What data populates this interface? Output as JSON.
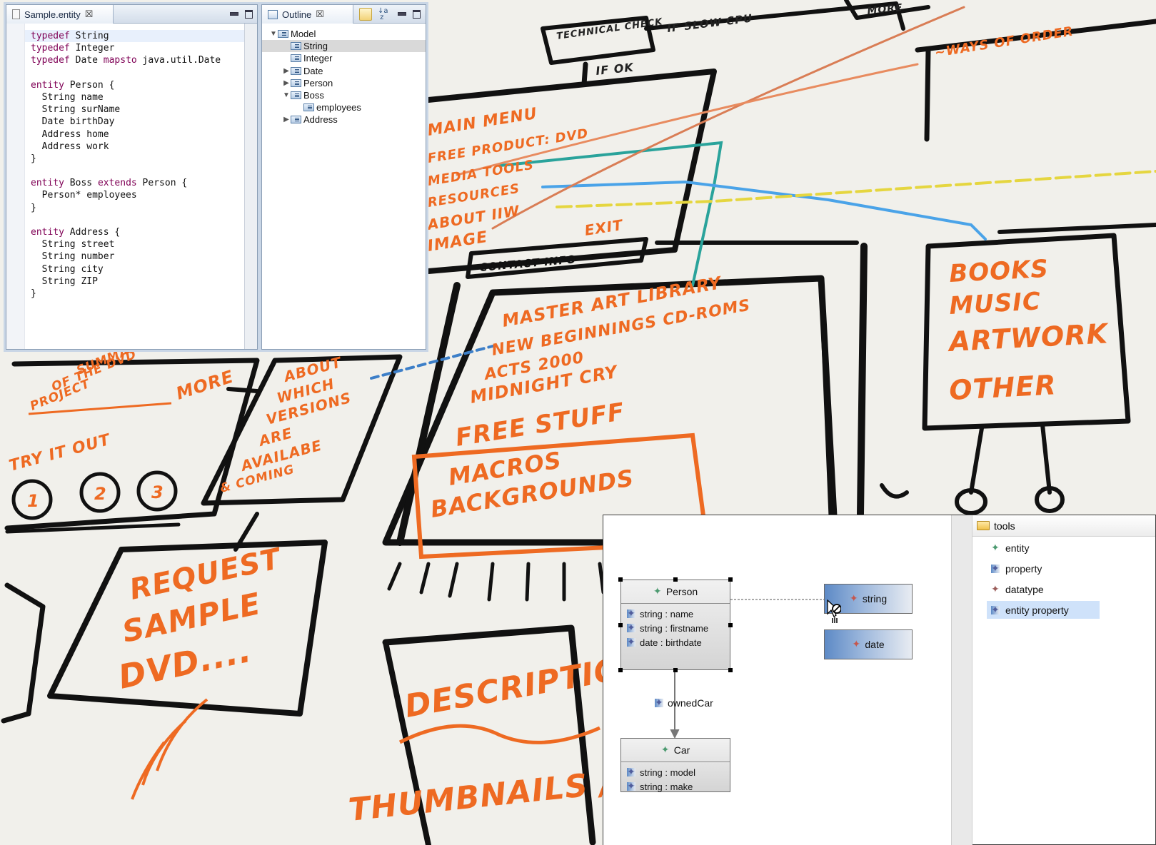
{
  "whiteboard": {
    "technical_check": "TECHNICAL CHECK",
    "if_slow_cpu": "IF SLOW CPU",
    "more_top": "MORE",
    "if_ok": "IF OK",
    "ways_of_order": "~WAYS OF ORDER",
    "menu_items": [
      "MAIN MENU",
      "FREE PRODUCT: DVD",
      "MEDIA TOOLS",
      "RESOURCES",
      "ABOUT IIW",
      "IMAGE"
    ],
    "exit": "EXIT",
    "contact_info": "CONTACT INFO",
    "categories": [
      "BOOKS",
      "MUSIC",
      "ARTWORK",
      "OTHER"
    ],
    "library": [
      "MASTER ART LIBRARY",
      "NEW BEGINNINGS CD-ROMS",
      "ACTS 2000",
      "MIDNIGHT CRY"
    ],
    "free_stuff": "FREE STUFF",
    "macros": [
      "MACROS",
      "BACKGROUNDS"
    ],
    "summary": [
      "SUMMARY",
      "OF THE DVD",
      "PROJECT"
    ],
    "more_left": "MORE",
    "about_versions": [
      "ABOUT",
      "WHICH",
      "VERSIONS",
      "ARE",
      "AVAILABE",
      "& COMING"
    ],
    "try_it_out": "TRY IT OUT",
    "steps": [
      "1",
      "2",
      "3"
    ],
    "request": [
      "REQUEST",
      "SAMPLE",
      "DVD...."
    ],
    "description": "DESCRIPTION",
    "thumbnails": "THUMBNAILS / P"
  },
  "editor": {
    "tab_label": "Sample.entity",
    "close_glyph": "☒",
    "lines": [
      [
        {
          "t": "typedef",
          "k": true
        },
        {
          "t": " String"
        }
      ],
      [
        {
          "t": "typedef",
          "k": true
        },
        {
          "t": " Integer"
        }
      ],
      [
        {
          "t": "typedef",
          "k": true
        },
        {
          "t": " Date "
        },
        {
          "t": "mapsto",
          "k": true
        },
        {
          "t": " java.util.Date"
        }
      ],
      [],
      [
        {
          "t": "entity",
          "k": true
        },
        {
          "t": " Person {"
        }
      ],
      [
        {
          "t": "  String name"
        }
      ],
      [
        {
          "t": "  String surName"
        }
      ],
      [
        {
          "t": "  Date birthDay"
        }
      ],
      [
        {
          "t": "  Address home"
        }
      ],
      [
        {
          "t": "  Address work"
        }
      ],
      [
        {
          "t": "}"
        }
      ],
      [],
      [
        {
          "t": "entity",
          "k": true
        },
        {
          "t": " Boss "
        },
        {
          "t": "extends",
          "k": true
        },
        {
          "t": " Person {"
        }
      ],
      [
        {
          "t": "  Person* employees"
        }
      ],
      [
        {
          "t": "}"
        }
      ],
      [],
      [
        {
          "t": "entity",
          "k": true
        },
        {
          "t": " Address {"
        }
      ],
      [
        {
          "t": "  String street"
        }
      ],
      [
        {
          "t": "  String number"
        }
      ],
      [
        {
          "t": "  String city"
        }
      ],
      [
        {
          "t": "  String ZIP"
        }
      ],
      [
        {
          "t": "}"
        }
      ]
    ]
  },
  "outline": {
    "tab_label": "Outline",
    "close_glyph": "☒",
    "tree": [
      {
        "label": "Model",
        "depth": 0,
        "twisty": "▼"
      },
      {
        "label": "String",
        "depth": 1,
        "twisty": "",
        "selected": true
      },
      {
        "label": "Integer",
        "depth": 1,
        "twisty": ""
      },
      {
        "label": "Date",
        "depth": 1,
        "twisty": "▶"
      },
      {
        "label": "Person",
        "depth": 1,
        "twisty": "▶"
      },
      {
        "label": "Boss",
        "depth": 1,
        "twisty": "▼"
      },
      {
        "label": "employees",
        "depth": 2,
        "twisty": ""
      },
      {
        "label": "Address",
        "depth": 1,
        "twisty": "▶"
      }
    ]
  },
  "diagram": {
    "person": {
      "title": "Person",
      "attrs": [
        "string : name",
        "string : firstname",
        "date : birthdate"
      ]
    },
    "car": {
      "title": "Car",
      "attrs": [
        "string : model",
        "string : make"
      ]
    },
    "string_type": "string",
    "date_type": "date",
    "relation_label": "ownedCar",
    "palette": {
      "title": "tools",
      "items": [
        {
          "label": "entity",
          "icon": "green"
        },
        {
          "label": "property",
          "icon": "blue"
        },
        {
          "label": "datatype",
          "icon": "brown"
        },
        {
          "label": "entity property",
          "icon": "blue",
          "selected": true
        }
      ]
    },
    "colors": {
      "keyword": "#7f0055",
      "selection": "#cfe2fa",
      "datatype_fill": "#5d8ac6"
    }
  }
}
